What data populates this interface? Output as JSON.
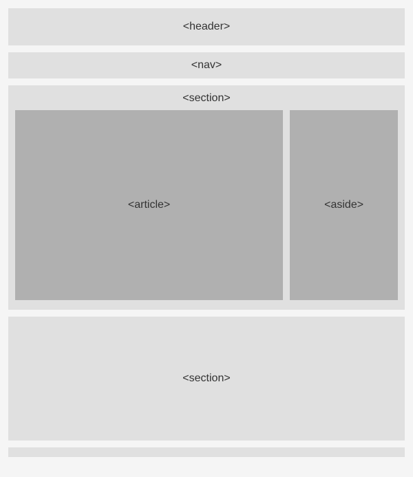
{
  "blocks": {
    "header": "<header>",
    "nav": "<nav>",
    "section1": "<section>",
    "article": "<article>",
    "aside": "<aside>",
    "section2": "<section>"
  }
}
